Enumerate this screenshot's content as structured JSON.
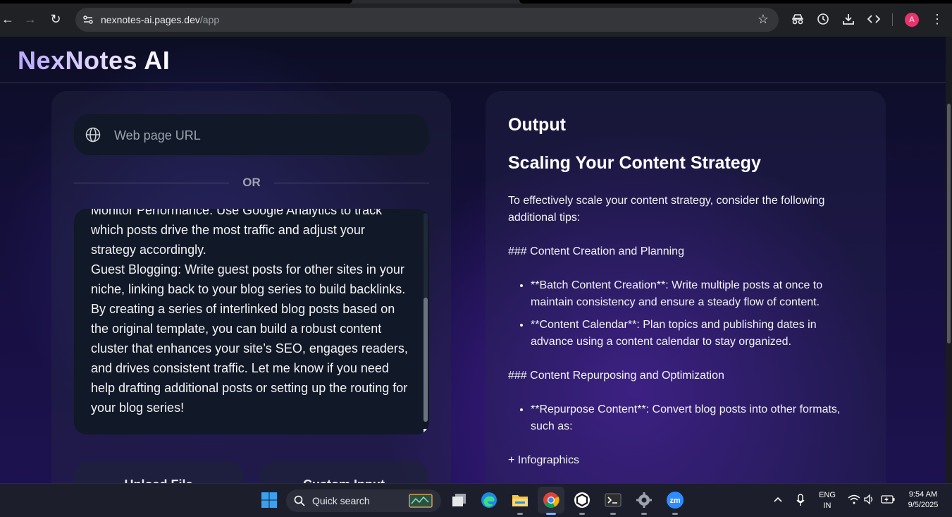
{
  "browser": {
    "url_host": "nexnotes-ai.pages.dev",
    "url_path": "/app",
    "avatar_letter": "A"
  },
  "app": {
    "brand": "NexNotes AI",
    "url_placeholder": "Web page URL",
    "or_label": "OR",
    "textarea_lines": [
      "Monitor Performance: Use Google Analytics to track which posts drive the most traffic and adjust your strategy accordingly.",
      "Guest Blogging: Write guest posts for other sites in your niche, linking back to your blog series to build backlinks.",
      "By creating a series of interlinked blog posts based on the original template, you can build a robust content cluster that enhances your site’s SEO, engages readers, and drives consistent traffic. Let me know if you need help drafting additional posts or setting up the routing for your blog series!"
    ],
    "buttons": [
      "Upload File",
      "Custom Input"
    ]
  },
  "output": {
    "title": "Output",
    "heading": "Scaling Your Content Strategy",
    "intro": "To effectively scale your content strategy, consider the following additional tips:",
    "section1": "### Content Creation and Planning",
    "section1_items": [
      "**Batch Content Creation**: Write multiple posts at once to maintain consistency and ensure a steady flow of content.",
      "**Content Calendar**: Plan topics and publishing dates in advance using a content calendar to stay organized."
    ],
    "section2": "### Content Repurposing and Optimization",
    "section2_items": [
      "**Repurpose Content**: Convert blog posts into other formats, such as:"
    ],
    "sub_item": "+ Infographics"
  },
  "taskbar": {
    "search_label": "Quick search",
    "lang_top": "ENG",
    "lang_bottom": "IN",
    "time": "9:54 AM",
    "date": "9/5/2025"
  },
  "colors": {
    "accent": "#8b5cf6",
    "panel": "#111827",
    "avatar": "#e8336d"
  }
}
